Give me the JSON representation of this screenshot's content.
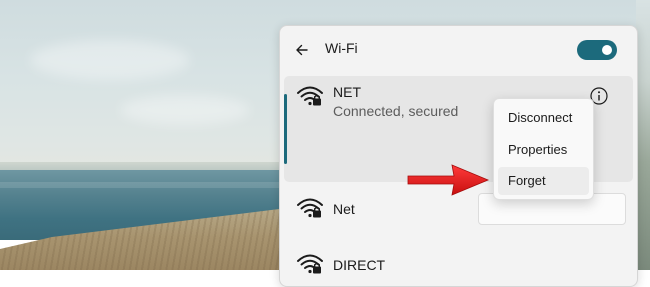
{
  "wifi_panel": {
    "title": "Wi-Fi",
    "toggle_state": "on",
    "accent_color": "#1c6a7c"
  },
  "networks": [
    {
      "name": "NET",
      "status": "Connected, secured",
      "connected": true,
      "secured": true
    },
    {
      "name": "Net",
      "secured": true
    },
    {
      "name": "DIRECT",
      "secured": true
    }
  ],
  "context_menu": {
    "items": [
      {
        "label": "Disconnect"
      },
      {
        "label": "Properties"
      },
      {
        "label": "Forget",
        "highlighted": true
      }
    ]
  },
  "annotation": {
    "type": "arrow",
    "color": "#e51b1b",
    "points_to": "Forget"
  },
  "icons": [
    "back-arrow-icon",
    "wifi-secured-icon",
    "info-icon"
  ]
}
